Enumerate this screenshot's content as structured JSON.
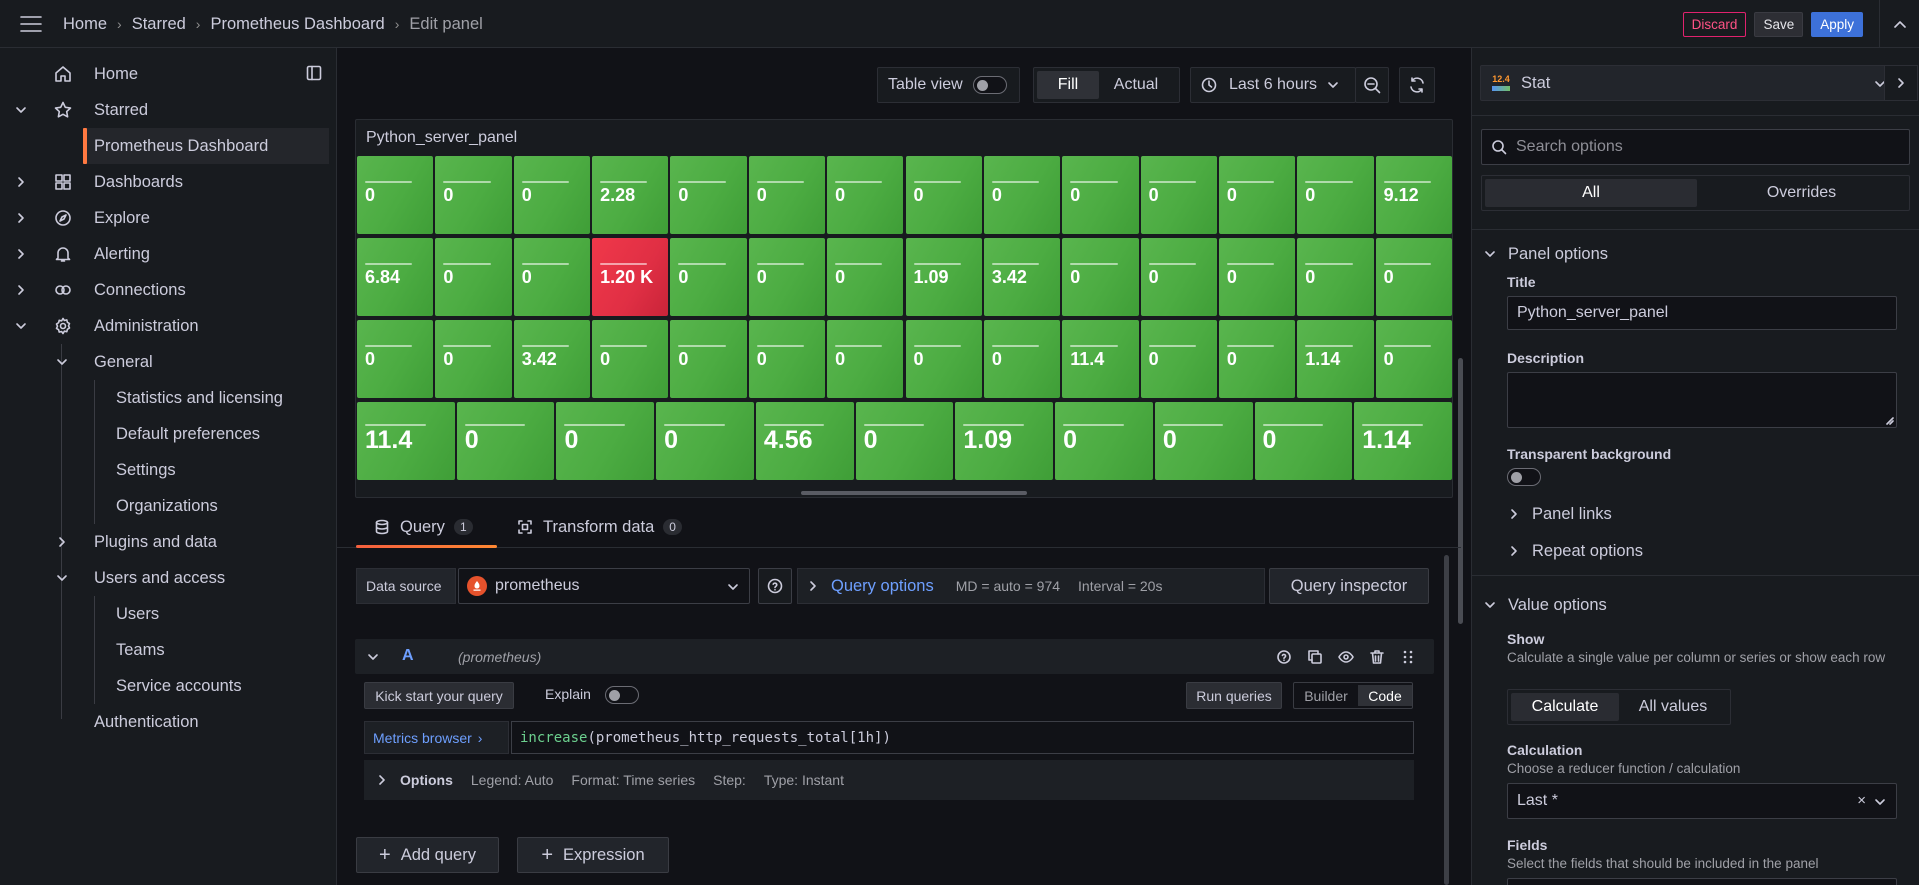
{
  "breadcrumbs": [
    "Home",
    "Starred",
    "Prometheus Dashboard",
    "Edit panel"
  ],
  "topbar": {
    "discard": "Discard",
    "save": "Save",
    "apply": "Apply"
  },
  "sidebar": {
    "home": "Home",
    "starred": "Starred",
    "starred_item": "Prometheus Dashboard",
    "dashboards": "Dashboards",
    "explore": "Explore",
    "alerting": "Alerting",
    "connections": "Connections",
    "administration": "Administration",
    "general": "General",
    "general_items": [
      "Statistics and licensing",
      "Default preferences",
      "Settings",
      "Organizations"
    ],
    "plugins": "Plugins and data",
    "users_access": "Users and access",
    "users_items": [
      "Users",
      "Teams",
      "Service accounts"
    ],
    "authentication": "Authentication"
  },
  "toolbar": {
    "table_view": "Table view",
    "fill": "Fill",
    "actual": "Actual",
    "time_range": "Last 6 hours"
  },
  "panel": {
    "title": "Python_server_panel",
    "rows": [
      [
        "0",
        "0",
        "0",
        "2.28",
        "0",
        "0",
        "0",
        "0",
        "0",
        "0",
        "0",
        "0",
        "0",
        "9.12"
      ],
      [
        "6.84",
        "0",
        "0",
        "1.20 K",
        "0",
        "0",
        "0",
        "1.09",
        "3.42",
        "0",
        "0",
        "0",
        "0",
        "0"
      ],
      [
        "0",
        "0",
        "3.42",
        "0",
        "0",
        "0",
        "0",
        "0",
        "0",
        "11.4",
        "0",
        "0",
        "1.14",
        "0"
      ],
      [
        "11.4",
        "0",
        "0",
        "0",
        "4.56",
        "0",
        "1.09",
        "0",
        "0",
        "0",
        "1.14"
      ]
    ],
    "colors": {
      "ok": "#52b04a",
      "alert": "#e02f44"
    }
  },
  "query_tabs": {
    "query": "Query",
    "query_count": "1",
    "transform": "Transform data",
    "transform_count": "0"
  },
  "datasource": {
    "label": "Data source",
    "value": "prometheus",
    "query_options": "Query options",
    "md": "MD = auto = 974",
    "interval": "Interval = 20s",
    "inspector": "Query inspector"
  },
  "query": {
    "ref": "A",
    "source": "(prometheus)",
    "kick_start": "Kick start your query",
    "explain": "Explain",
    "run": "Run queries",
    "builder": "Builder",
    "code": "Code",
    "metrics_browser": "Metrics browser",
    "expr_fn": "increase",
    "expr_rest": "(prometheus_http_requests_total[1h])",
    "options": "Options",
    "legend": "Legend: Auto",
    "format": "Format: Time series",
    "step": "Step:",
    "type": "Type: Instant"
  },
  "actions": {
    "add_query": "Add query",
    "expression": "Expression"
  },
  "options_pane": {
    "viz": "Stat",
    "viz_badge": "12.4",
    "search_placeholder": "Search options",
    "tab_all": "All",
    "tab_overrides": "Overrides",
    "panel_options": "Panel options",
    "title_label": "Title",
    "title_value": "Python_server_panel",
    "description_label": "Description",
    "transparent": "Transparent background",
    "panel_links": "Panel links",
    "repeat_options": "Repeat options",
    "value_options": "Value options",
    "show_label": "Show",
    "show_desc": "Calculate a single value per column or series or show each row",
    "calculate": "Calculate",
    "all_values": "All values",
    "calculation_label": "Calculation",
    "calculation_desc": "Choose a reducer function / calculation",
    "calculation_value": "Last *",
    "fields_label": "Fields",
    "fields_desc": "Select the fields that should be included in the panel"
  }
}
